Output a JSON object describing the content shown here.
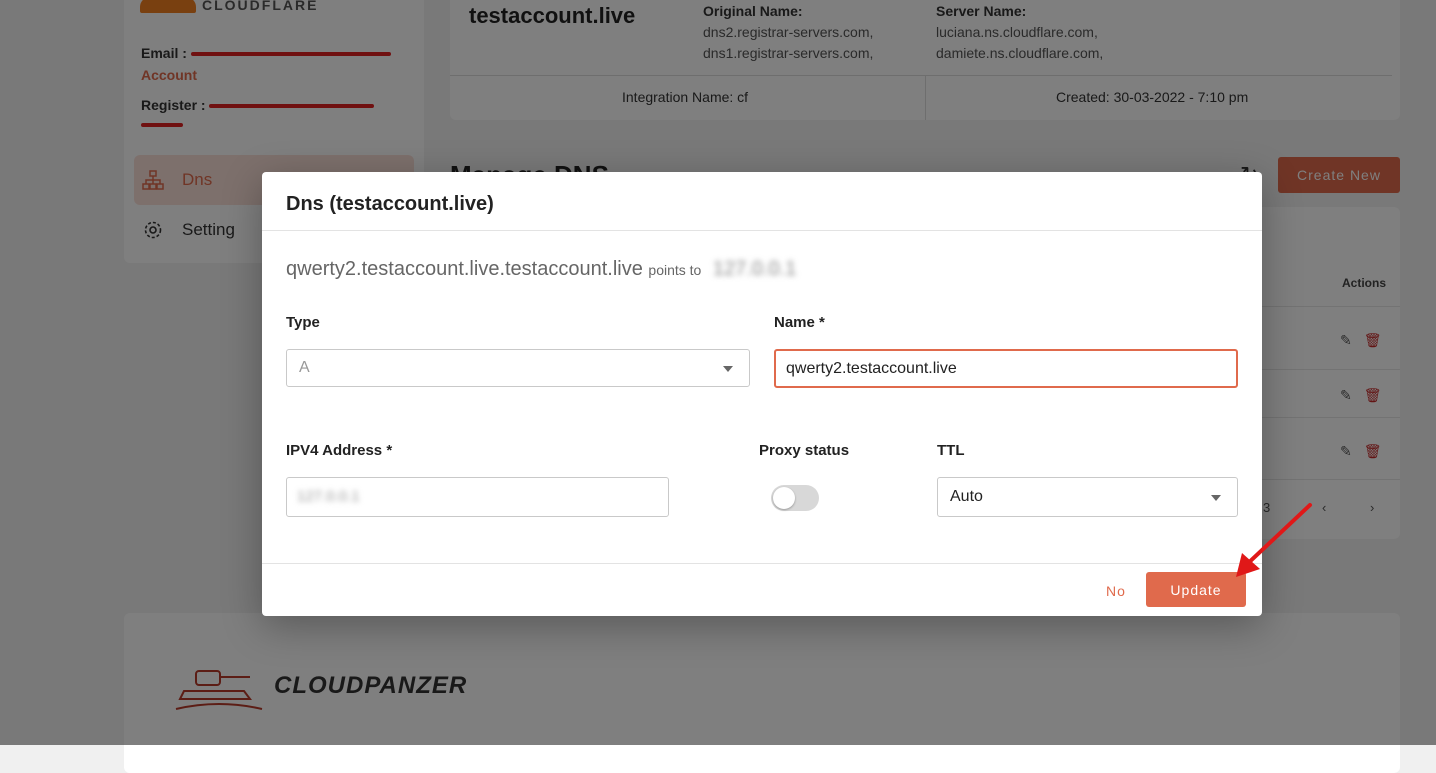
{
  "sidebar": {
    "brand": "CLOUDFLARE",
    "email_label": "Email :",
    "account_label": "Account",
    "register_label": "Register :",
    "items": [
      {
        "label": "Dns",
        "icon": "sitemap-icon"
      },
      {
        "label": "Setting",
        "icon": "gear-icon"
      }
    ]
  },
  "domain_card": {
    "domain": "testaccount.live",
    "original_name_label": "Original Name:",
    "original_names": [
      "dns2.registrar-servers.com,",
      "dns1.registrar-servers.com,"
    ],
    "server_name_label": "Server Name:",
    "server_names": [
      "luciana.ns.cloudflare.com,",
      "damiete.ns.cloudflare.com,"
    ],
    "integration": "Integration Name: cf",
    "created": "Created: 30-03-2022 - 7:10 pm"
  },
  "manage": {
    "title": "Manage DNS",
    "create_label": "Create New",
    "actions_header": "Actions",
    "pager_text": "3"
  },
  "brand_footer": {
    "name": "CLOUDPANZER"
  },
  "modal": {
    "title": "Dns (testaccount.live)",
    "record_full": "qwerty2.testaccount.live.testaccount.live",
    "points_to": "points to",
    "target_ip": "127.0.0.1",
    "type_label": "Type",
    "type_value": "A",
    "name_label": "Name *",
    "name_value": "qwerty2.testaccount.live",
    "ip_label": "IPV4 Address *",
    "ip_value": "127.0.0.1",
    "proxy_label": "Proxy status",
    "proxy_on": false,
    "ttl_label": "TTL",
    "ttl_value": "Auto",
    "no_label": "No",
    "update_label": "Update"
  },
  "colors": {
    "accent": "#e06a4c",
    "annotation_arrow": "#e01818"
  }
}
